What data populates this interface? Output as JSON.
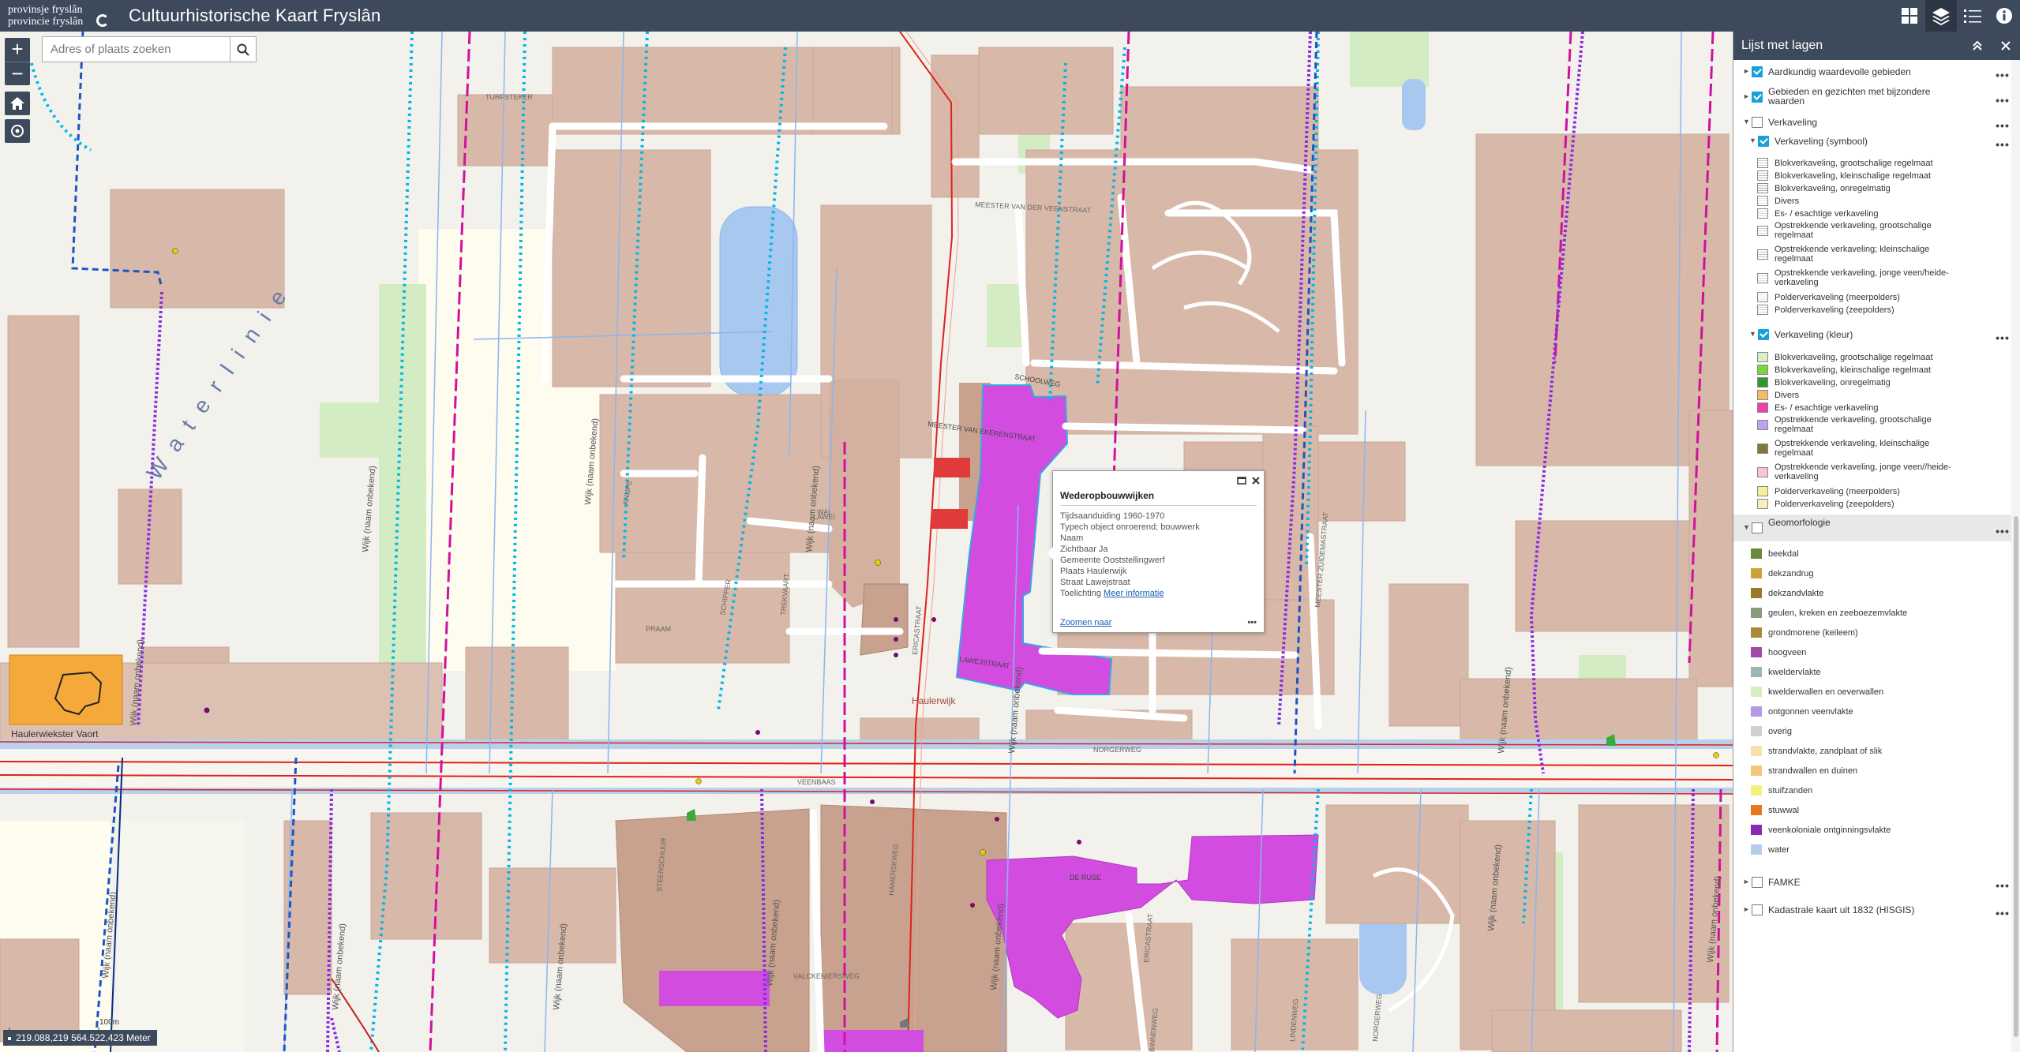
{
  "header": {
    "logo_line1": "provinsje fryslân",
    "logo_line2": "provincie fryslân",
    "title": "Cultuurhistorische Kaart Fryslân",
    "tools": [
      {
        "name": "basemap-gallery-icon"
      },
      {
        "name": "layers-icon"
      },
      {
        "name": "legend-list-icon"
      },
      {
        "name": "info-icon"
      }
    ]
  },
  "search": {
    "placeholder": "Adres of plaats zoeken"
  },
  "map_controls": {
    "zoom_in": "+",
    "zoom_out": "−"
  },
  "coordinates": "219.088,219 564.522,423 Meter",
  "scalebar": "100m",
  "map_labels": {
    "waterlinie": "Waterlinie",
    "vaort": "Haulerwiekster Vaort",
    "haulerwijk": "Haulerwijk",
    "wijk_onbekend": "Wijk (naam onbekend)",
    "turfsteker": "TURFSTEKER",
    "meester_van_der_veen": "MEESTER VAN DER VEENSTRAAT",
    "meester_van_ekeren": "MEESTER VAN EKERENSTRAAT",
    "schoolweg": "SCHOOLWEG",
    "lawei": "LAWEI",
    "praam": "PRAAM",
    "schipper": "SCHIPPER",
    "trekvaart": "TREKVAART",
    "wal": "WAL",
    "knijpe": "KNIJPE",
    "ericastraat": "ERICASTRAAT",
    "lawejstraat": "LAWEJSTRAAT",
    "norgerweg": "NORGERWEG",
    "veenbaas": "VEENBAAS",
    "valckeniersweg": "VALCKENIERSWEG",
    "de_ruse": "DE RUSE",
    "meester_zuidema": "MEESTER ZUIDEMASTRAAT",
    "steenschuur": "STEENSCHUUR",
    "hamerskweg": "HAMERSKWEG",
    "meester_veenstra": "MEESTER VEENSTRAAT",
    "ericastraat2": "ERICASTRAAT",
    "binnenweg": "BINNENWEG",
    "lindenweg": "LINDENWEG",
    "norgerweg2": "NORGERWEG"
  },
  "popup": {
    "title": "Wederopbouwwijken",
    "rows": [
      "Tijdsaanduiding 1960-1970",
      "Typech object onroerend; bouwwerk",
      "Naam",
      "Zichtbaar Ja",
      "Gemeente Ooststellingwerf",
      "Plaats Haulerwijk",
      "Straat Lawejstraat"
    ],
    "toelichting_label": "Toelichting",
    "toelichting_link": "Meer informatie",
    "zoom_link": "Zoomen naar",
    "more": "•••"
  },
  "panel": {
    "title": "Lijst met lagen",
    "more": "•••",
    "items": [
      {
        "label": "Aardkundig waardevolle gebieden",
        "checked": true,
        "caret": "►",
        "more": true
      },
      {
        "label": "Gebieden en gezichten met bijzondere waarden",
        "checked": true,
        "caret": "►",
        "more": true
      },
      {
        "label": "Verkaveling",
        "checked": false,
        "caret": "▼",
        "more": true
      },
      {
        "label": "Verkaveling (symbool)",
        "checked": true,
        "caret": "▼",
        "more": true
      },
      {
        "label": "Blokverkaveling, grootschalige regelmaat"
      },
      {
        "label": "Blokverkaveling, kleinschalige regelmaat"
      },
      {
        "label": "Blokverkaveling, onregelmatig"
      },
      {
        "label": "Divers"
      },
      {
        "label": "Es- / esachtige verkaveling"
      },
      {
        "label": "Opstrekkende verkaveling, grootschalige regelmaat"
      },
      {
        "label": "Opstrekkende verkaveling; kleinschalige regelmaat"
      },
      {
        "label": "Opstrekkende verkaveling, jonge veen/heide-verkaveling"
      },
      {
        "label": "Polderverkaveling (meerpolders)"
      },
      {
        "label": "Polderverkaveling (zeepolders)"
      },
      {
        "label": "Verkaveling (kleur)",
        "checked": true,
        "caret": "▼",
        "more": true
      },
      {
        "label": "Blokverkaveling, grootschalige regelmaat",
        "color": "#d4f0c4"
      },
      {
        "label": "Blokverkaveling, kleinschalige regelmaat",
        "color": "#7bd63a"
      },
      {
        "label": "Blokverkaveling, onregelmatig",
        "color": "#2e9a2a"
      },
      {
        "label": "Divers",
        "color": "#f2bd6a"
      },
      {
        "label": "Es- / esachtige verkaveling",
        "color": "#ee3fa8"
      },
      {
        "label": "Opstrekkende verkaveling, grootschalige regelmaat",
        "color": "#b9a3f2"
      },
      {
        "label": "Opstrekkende verkaveling, kleinschalige regelmaat",
        "color": "#807a3a"
      },
      {
        "label": "Opstrekkende verkaveling, jonge veen//heide-verkaveling",
        "color": "#f6c2dc"
      },
      {
        "label": "Polderverkaveling (meerpolders)",
        "color": "#f3f09a"
      },
      {
        "label": "Polderverkaveling (zeepolders)",
        "color": "#f7efc2"
      },
      {
        "label": "Geomorfologie",
        "checked": false,
        "caret": "▼",
        "more": true
      },
      {
        "label": "beekdal",
        "color": "#6a8a3a"
      },
      {
        "label": "dekzandrug",
        "color": "#c8a43a"
      },
      {
        "label": "dekzandvlakte",
        "color": "#9a7a2a"
      },
      {
        "label": "geulen, kreken en zeeboezemvlakte",
        "color": "#8a9a7a"
      },
      {
        "label": "grondmorene (keileem)",
        "color": "#a88a3a"
      },
      {
        "label": "hoogveen",
        "color": "#a04aa8"
      },
      {
        "label": "kweldervlakte",
        "color": "#9ab8b2"
      },
      {
        "label": "kwelderwallen en oeverwallen",
        "color": "#d8ecc2"
      },
      {
        "label": "ontgonnen veenvlakte",
        "color": "#b49ae6"
      },
      {
        "label": "overig",
        "color": "#cfcfcf"
      },
      {
        "label": "strandvlakte, zandplaat of slik",
        "color": "#f6e2a8"
      },
      {
        "label": "strandwallen en duinen",
        "color": "#f2c878"
      },
      {
        "label": "stuifzanden",
        "color": "#f4f27a"
      },
      {
        "label": "stuwwal",
        "color": "#e8781a"
      },
      {
        "label": "veenkoloniale ontginningsvlakte",
        "color": "#8a2ab2"
      },
      {
        "label": "water",
        "color": "#b6cdea"
      },
      {
        "label": "FAMKE",
        "checked": false,
        "caret": "►",
        "more": true
      },
      {
        "label": "Kadastrale kaart uit 1832 (HISGIS)",
        "checked": false,
        "caret": "►",
        "more": true
      }
    ]
  },
  "colors": {
    "header_bg": "#3d4a5c",
    "accent": "#1a9fd9",
    "wederopbouw": "#d24ce0",
    "dike_magenta": "#c8109a",
    "purple_route": "#8a2be2",
    "blue_dashed": "#1d55c4",
    "cyan_dotted": "#00b7e8",
    "road_red": "#e0221a"
  }
}
